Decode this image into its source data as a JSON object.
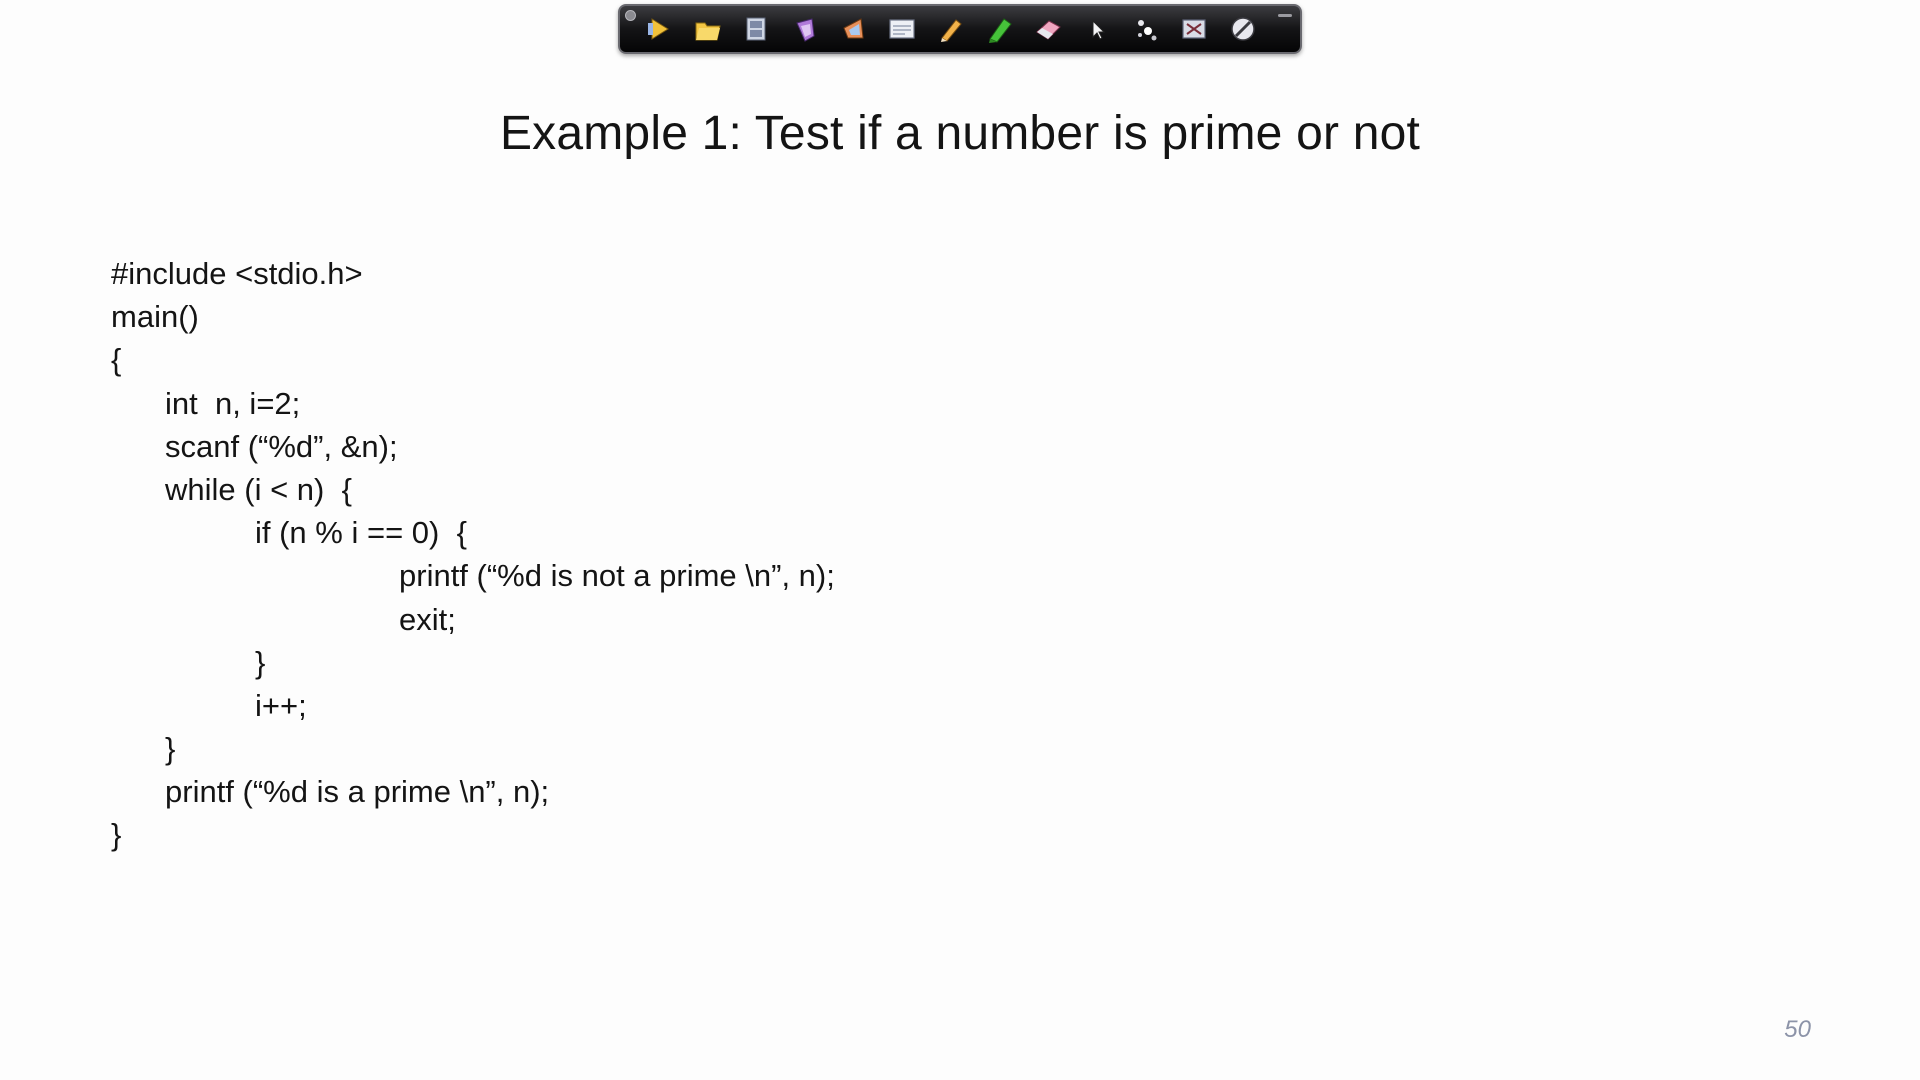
{
  "toolbar": {
    "buttons": [
      {
        "name": "play-slideshow-button",
        "icon": "play-arrow-icon"
      },
      {
        "name": "open-file-button",
        "icon": "folder-icon"
      },
      {
        "name": "slides-button",
        "icon": "film-strip-icon"
      },
      {
        "name": "previous-slide-button",
        "icon": "back-arrow-icon"
      },
      {
        "name": "next-slide-button",
        "icon": "forward-arrow-icon"
      },
      {
        "name": "whiteboard-button",
        "icon": "whiteboard-icon"
      },
      {
        "name": "pen-tool-button",
        "icon": "pencil-icon"
      },
      {
        "name": "highlighter-button",
        "icon": "green-marker-icon"
      },
      {
        "name": "eraser-button",
        "icon": "eraser-icon"
      },
      {
        "name": "pointer-button",
        "icon": "cursor-arrow-icon"
      },
      {
        "name": "laser-pointer-button",
        "icon": "spotlight-dots-icon"
      },
      {
        "name": "clear-screen-button",
        "icon": "clear-screen-icon"
      },
      {
        "name": "stop-button",
        "icon": "no-sign-icon"
      }
    ]
  },
  "slide": {
    "title": "Example 1: Test if a number is prime or not",
    "code_lines": [
      {
        "indent": 0,
        "text": "#include <stdio.h>"
      },
      {
        "indent": 0,
        "text": "main()"
      },
      {
        "indent": 0,
        "text": "{"
      },
      {
        "indent": 1,
        "text": "int  n, i=2;"
      },
      {
        "indent": 1,
        "text": "scanf (“%d”, &n);"
      },
      {
        "indent": 1,
        "text": "while (i < n)  {"
      },
      {
        "indent": 2,
        "text": "if (n % i == 0)  {"
      },
      {
        "indent": 3,
        "text": "printf (“%d is not a prime \\n”, n);"
      },
      {
        "indent": 3,
        "text": "exit;"
      },
      {
        "indent": 2,
        "text": "}"
      },
      {
        "indent": 2,
        "text": "i++;"
      },
      {
        "indent": 1,
        "text": "}"
      },
      {
        "indent": 1,
        "text": "printf (“%d is a prime \\n”, n);"
      },
      {
        "indent": 0,
        "text": "}"
      }
    ],
    "page_number": "50"
  },
  "colors": {
    "background": "#fdfdfd",
    "text": "#141414",
    "toolbar": "#141416",
    "page_number": "#8c93a8"
  }
}
